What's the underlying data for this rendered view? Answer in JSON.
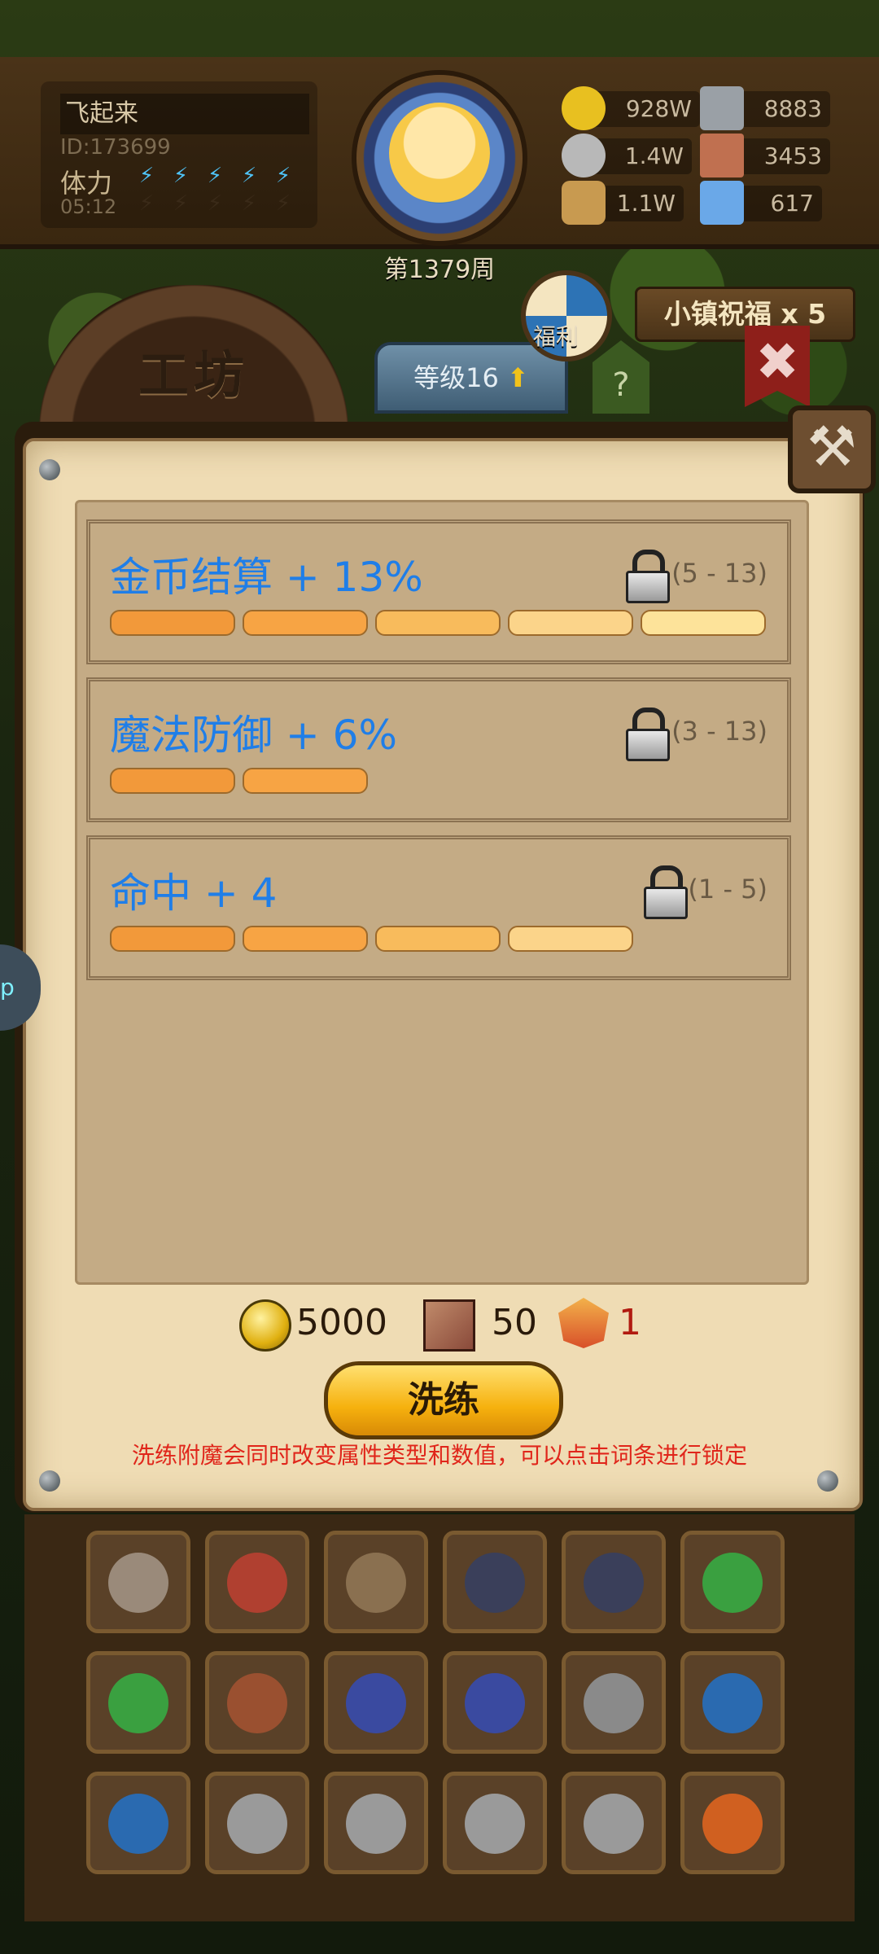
{
  "hud": {
    "player_name": "飞起来",
    "player_id": "ID:173699",
    "stamina_label": "体力",
    "stamina_timer": "05:12",
    "week": "第1379周",
    "resources": [
      {
        "name": "gold",
        "value": "928W",
        "color": "#e8c020"
      },
      {
        "name": "iron",
        "value": "8883",
        "color": "#9aa0a6"
      },
      {
        "name": "stone",
        "value": "1.4W",
        "color": "#b8b8b8"
      },
      {
        "name": "leather",
        "value": "3453",
        "color": "#c07050"
      },
      {
        "name": "wood",
        "value": "1.1W",
        "color": "#c89a50"
      },
      {
        "name": "crystal",
        "value": "617",
        "color": "#6aa8e8"
      }
    ]
  },
  "nav": {
    "workshop_title": "工坊",
    "level_label": "等级16",
    "help_label": "?",
    "welfare_label": "福利",
    "blessing_label": "小镇祝福 x 5",
    "close_flag": "✖"
  },
  "popup": {
    "close_icon": "⚒",
    "affixes": [
      {
        "title": "金币结算 + 13%",
        "range": "(5 - 13)",
        "level": 5
      },
      {
        "title": "魔法防御 + 6%",
        "range": "(3 - 13)",
        "level": 2
      },
      {
        "title": "命中 + 4",
        "range": "(1 - 5)",
        "level": 4
      }
    ],
    "cost": {
      "gold": "5000",
      "scroll": "50",
      "gem": "1"
    },
    "wash_label": "洗练",
    "hint": "洗练附魔会同时改变属性类型和数值，可以点击词条进行锁定"
  },
  "side_tab": "p",
  "segment_colors": [
    "#f2993a",
    "#f7a444",
    "#f8bb5c",
    "#fbd48a",
    "#fde39a"
  ]
}
